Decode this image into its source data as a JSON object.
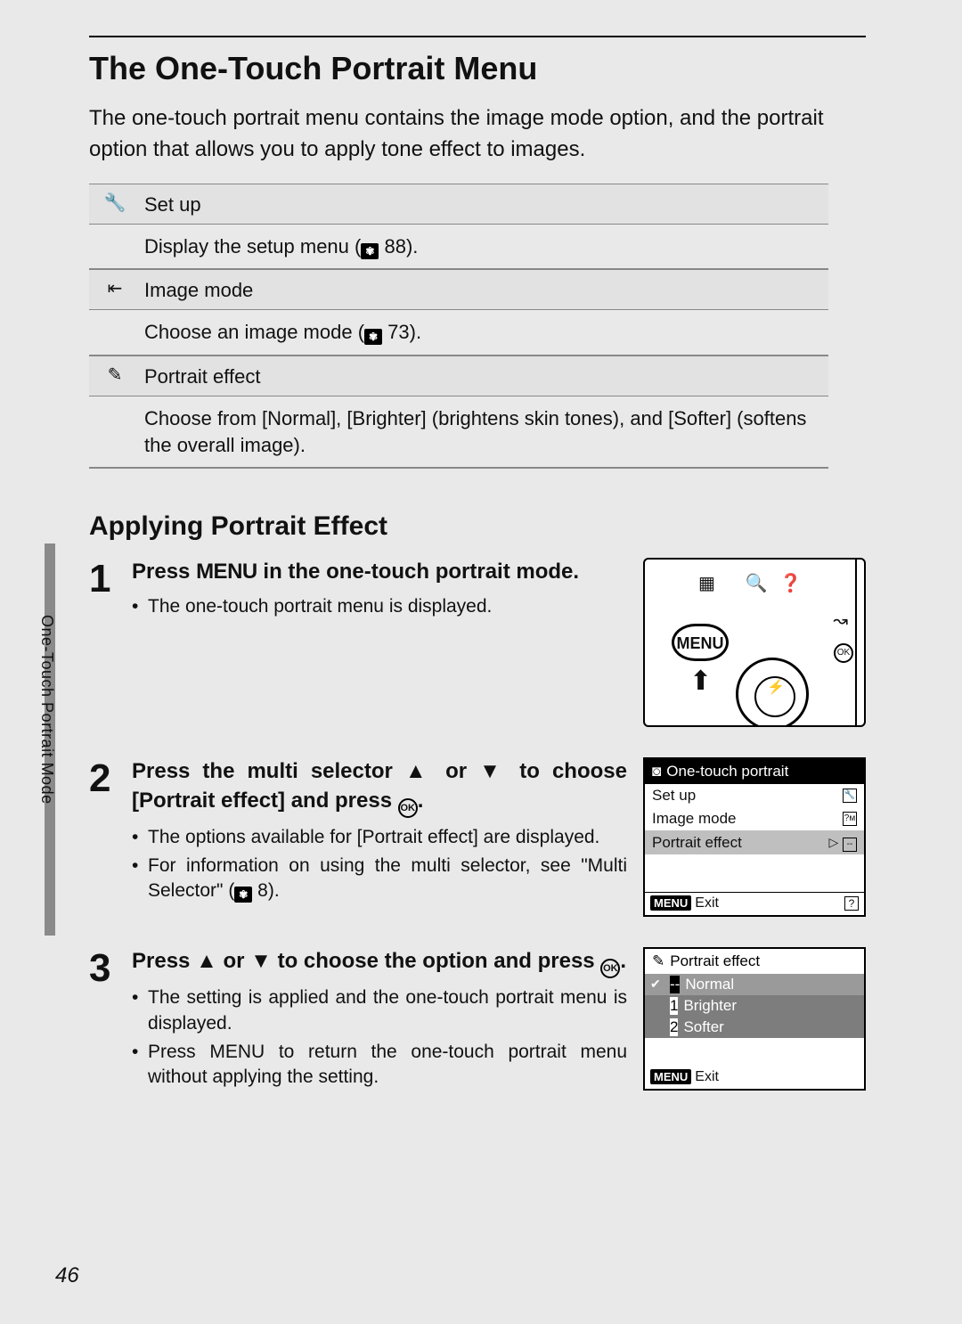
{
  "page_number": "46",
  "side_label": "One-Touch Portrait Mode",
  "heading": "The One-Touch Portrait Menu",
  "intro": "The one-touch portrait menu contains the image mode option, and the portrait option that allows you to apply tone effect to images.",
  "options": [
    {
      "icon": "🔧",
      "label": "Set up",
      "desc_pre": "Display the setup menu (",
      "desc_ref": "88",
      "desc_post": ")."
    },
    {
      "icon": "⇤",
      "label": "Image mode",
      "desc_pre": "Choose an image mode (",
      "desc_ref": "73",
      "desc_post": ")."
    },
    {
      "icon": "✎",
      "label": "Portrait effect",
      "desc_pre": "Choose from [Normal], [Brighter] (brightens skin tones), and [Softer] (softens the overall image).",
      "desc_ref": "",
      "desc_post": ""
    }
  ],
  "section2": "Applying Portrait Effect",
  "step1": {
    "num": "1",
    "title_pre": "Press ",
    "title_menu": "MENU",
    "title_post": " in the one-touch portrait mode.",
    "b1": "The one-touch portrait menu is displayed.",
    "illus_top_icons": "▦   🔍❓",
    "illus_menu": "MENU",
    "illus_ok": "OK"
  },
  "step2": {
    "num": "2",
    "title_a": "Press the multi selector ",
    "title_b": " or ",
    "title_c": " to choose [Portrait effect] and press ",
    "title_ok": "OK",
    "title_d": ".",
    "b1": "The options available for [Portrait effect] are displayed.",
    "b2_a": "For information on using the multi selector, see \"Multi Selector\" (",
    "b2_ref": "8",
    "b2_b": ").",
    "lcd": {
      "title": "One-touch portrait",
      "r1": "Set up",
      "r2": "Image mode",
      "r3": "Portrait effect",
      "r2_badge": "?ᴍ",
      "exit": "Exit",
      "menu_badge": "MENU",
      "help": "?"
    }
  },
  "step3": {
    "num": "3",
    "title_a": "Press ",
    "title_b": " or ",
    "title_c": " to choose the option and press ",
    "title_ok": "OK",
    "title_d": ".",
    "b1": "The setting is applied and the one-touch portrait menu is displayed.",
    "b2_a": "Press ",
    "b2_menu": "MENU",
    "b2_b": " to return the one-touch portrait menu without applying the setting.",
    "lcd": {
      "title": "Portrait effect",
      "o1": "Normal",
      "o2": "Brighter",
      "o3": "Softer",
      "exit": "Exit",
      "menu_badge": "MENU"
    }
  }
}
